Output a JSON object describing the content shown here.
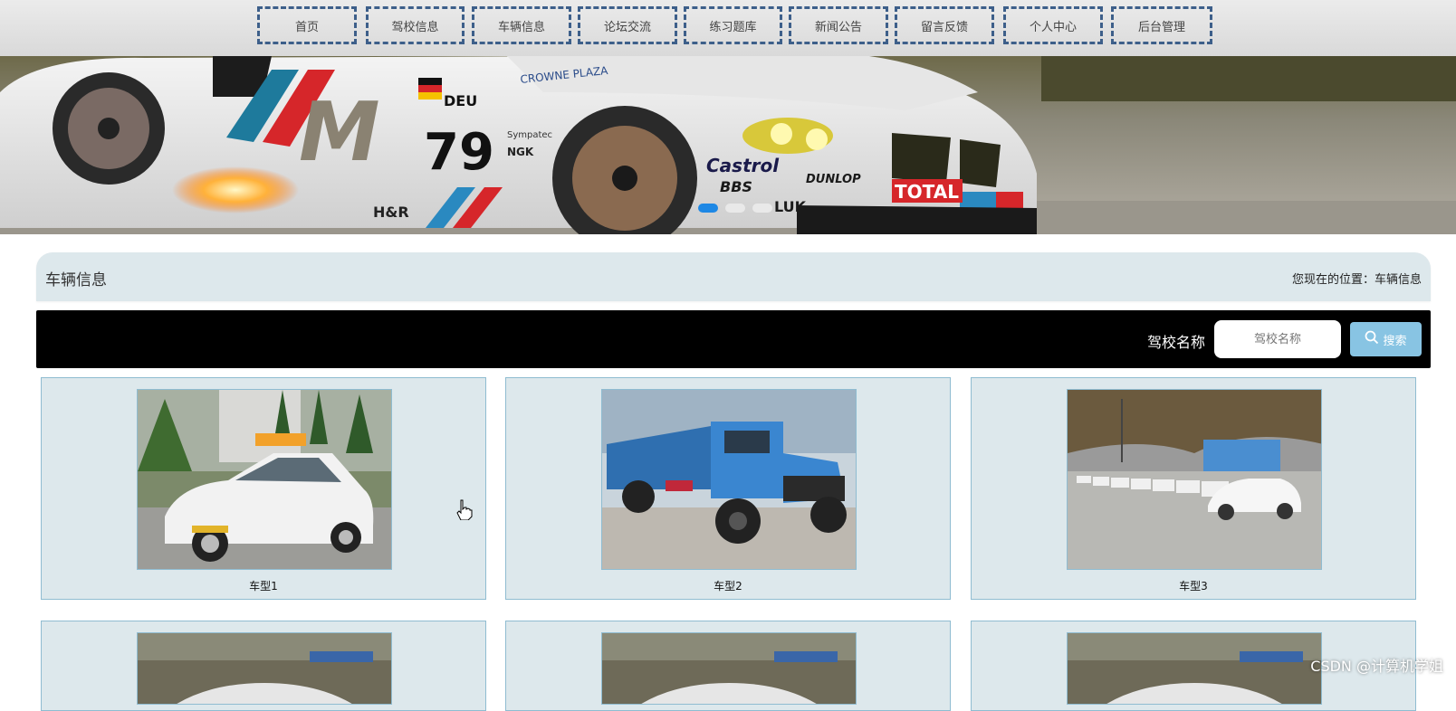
{
  "nav": {
    "items": [
      {
        "label": "首页"
      },
      {
        "label": "驾校信息"
      },
      {
        "label": "车辆信息"
      },
      {
        "label": "论坛交流"
      },
      {
        "label": "练习题库"
      },
      {
        "label": "新闻公告"
      },
      {
        "label": "留言反馈"
      },
      {
        "label": "个人中心"
      },
      {
        "label": "后台管理"
      }
    ]
  },
  "banner": {
    "car_texts": [
      "DEU",
      "79",
      "CROWNE PLAZA",
      "Castrol",
      "BBS",
      "DUNLOP",
      "TOTAL",
      "LUK",
      "H&R",
      "NGK",
      "Sympatec"
    ],
    "active_slide": 1,
    "slide_count": 3
  },
  "page": {
    "title": "车辆信息",
    "location_label": "您现在的位置：",
    "location_value": "车辆信息"
  },
  "search": {
    "label": "驾校名称",
    "placeholder": "驾校名称",
    "button_label": "搜索"
  },
  "vehicles": [
    {
      "name": "车型1"
    },
    {
      "name": "车型2"
    },
    {
      "name": "车型3"
    }
  ],
  "watermark": "CSDN @计算机学姐",
  "colors": {
    "nav_border": "#3d5f8a",
    "panel_bg": "#dde8ec",
    "search_button": "#88c4e3",
    "active_dot": "#1e88e5"
  }
}
